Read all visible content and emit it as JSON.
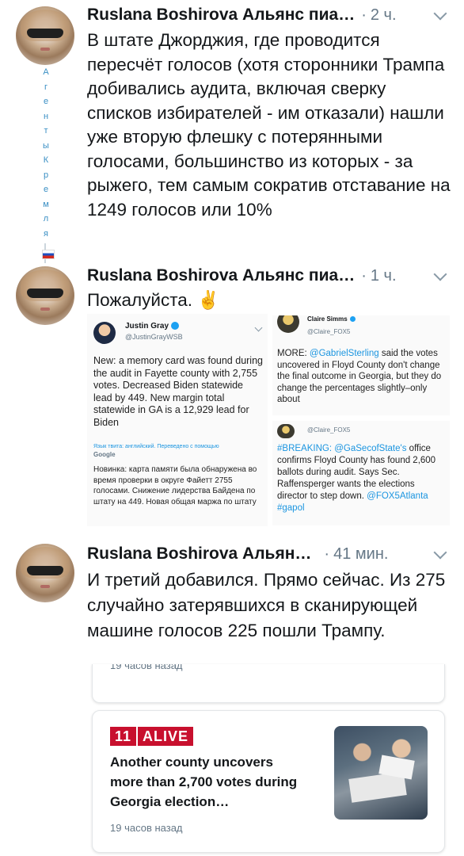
{
  "tweets": [
    {
      "author": "Ruslana Boshirova Альянс пиа…",
      "time": "2 ч.",
      "text": "В штате Джорджия, где проводится пересчёт голосов (хотя сторонники Трампа добивались аудита, включая сверку списков избирателей - им отказали) нашли уже вторую флешку с потерянными голосами, большинство из которых - за рыжего, тем самым сократив отставание на 1249 голосов или 10%"
    },
    {
      "author": "Ruslana Boshirova Альянс пиа…",
      "time": "1 ч.",
      "text": "Пожалуйста. ✌️"
    },
    {
      "author": "Ruslana Boshirova Альян…",
      "time": "41 мин.",
      "text": "И третий добавился. Прямо сейчас. Из 275 случайно затерявшихся в сканирующей машине голосов 225 пошли Трампу."
    }
  ],
  "vertical_label_1": [
    "А",
    "г",
    "е",
    "н",
    "т",
    "ы"
  ],
  "vertical_label_2": [
    "К",
    "р",
    "е",
    "м",
    "л",
    "я"
  ],
  "embed_left": {
    "name": "Justin Gray",
    "handle": "@JustinGrayWSB",
    "text": "New: a memory card was found during the audit in Fayette county with 2,755 votes. Decreased Biden statewide lead by 449. New margin total statewide in GA is a 12,929 lead for Biden",
    "translate_note": "Язык твита: английский. Переведено с помощью",
    "translate_brand": "Google",
    "translation": "Новинка: карта памяти была обнаружена во время проверки в округе Файетт 2755 голосами. Снижение лидерства Байдена по штату на 449. Новая общая маржа по штату"
  },
  "embed_right_top": {
    "name": "Claire Simms",
    "handle": "@Claire_FOX5",
    "prefix": "MORE:",
    "mention": "@GabrielSterling",
    "text": "said the votes uncovered in Floyd County don't change the final outcome in Georgia, but they do change the percentages slightly–only about"
  },
  "embed_right_bottom": {
    "handle": "@Claire_FOX5",
    "hashtag": "#BREAKING:",
    "mention": "@GaSecofState's",
    "text": "office confirms Floyd County has found 2,600 ballots during audit. Says Sec. Raffensperger wants the elections director to step down.",
    "links": "@FOX5Atlanta #gapol"
  },
  "card_cut_text": "19 часов назад",
  "news_card": {
    "logo_bars": "11",
    "logo_word": "ALIVE",
    "headline": "Another county uncovers more than 2,700 votes during Georgia election…",
    "time": "19 часов назад"
  },
  "colors": {
    "link": "#1b95e0",
    "grey": "#657786",
    "logo_red": "#c8102e"
  }
}
